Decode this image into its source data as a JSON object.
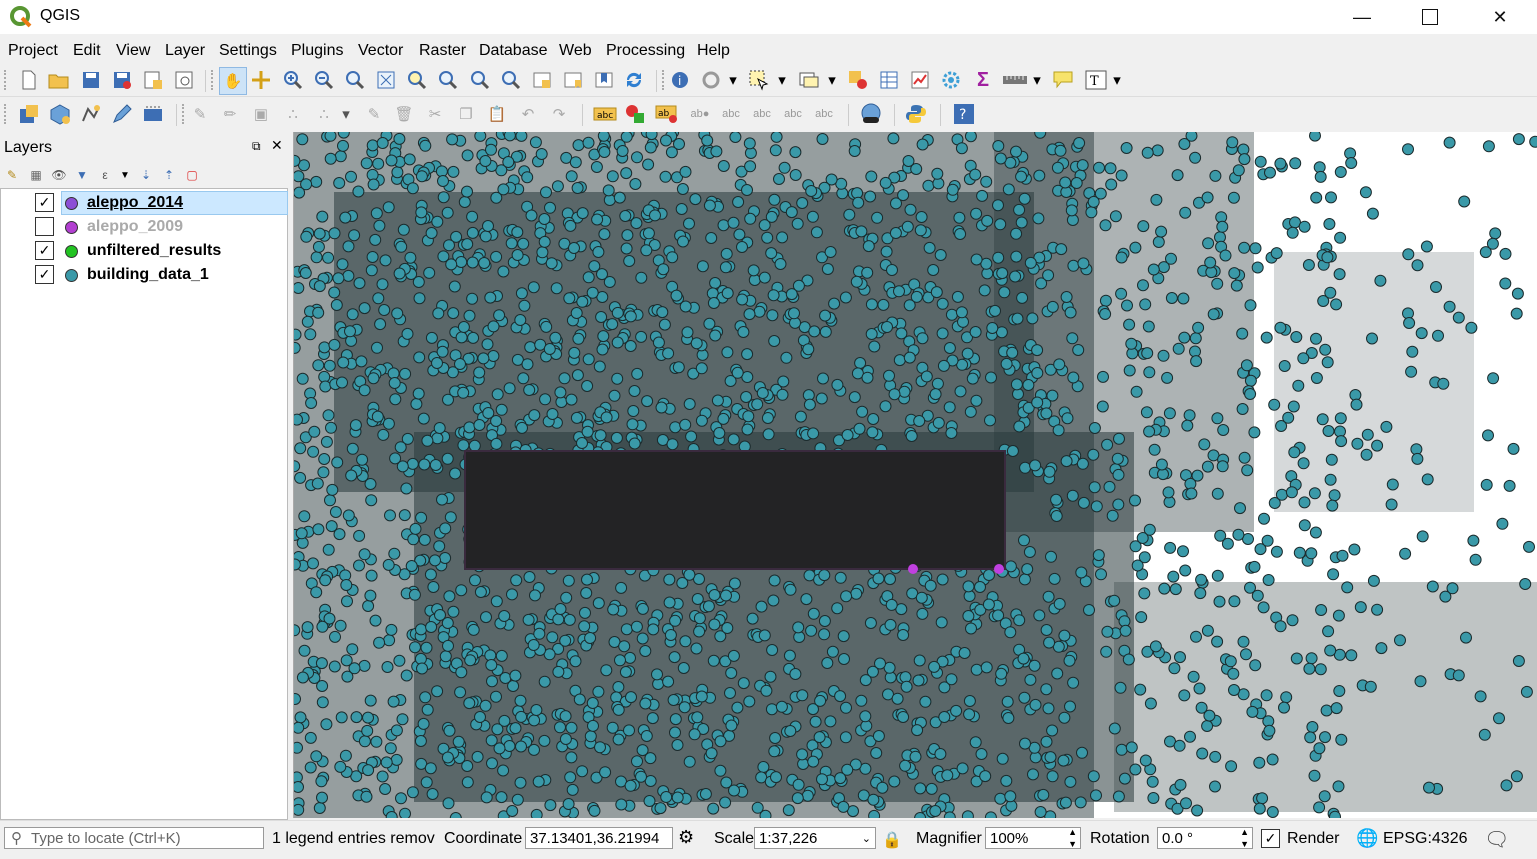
{
  "window": {
    "title": "QGIS"
  },
  "menu": [
    "Project",
    "Edit",
    "View",
    "Layer",
    "Settings",
    "Plugins",
    "Vector",
    "Raster",
    "Database",
    "Web",
    "Processing",
    "Help"
  ],
  "layers_panel": {
    "title": "Layers",
    "layers": [
      {
        "name": "aleppo_2014",
        "checked": true,
        "color": "#8c4fd6",
        "selected": true,
        "dim": false
      },
      {
        "name": "aleppo_2009",
        "checked": false,
        "color": "#b23fd1",
        "selected": false,
        "dim": true
      },
      {
        "name": "unfiltered_results",
        "checked": true,
        "color": "#22c322",
        "selected": false,
        "dim": false
      },
      {
        "name": "building_data_1",
        "checked": true,
        "color": "#3a99a8",
        "selected": false,
        "dim": false
      }
    ]
  },
  "statusbar": {
    "locate_placeholder": "Type to locate (Ctrl+K)",
    "message": "1 legend entries remov",
    "coordinate_label": "Coordinate",
    "coordinate_value": "37.13401,36.21994",
    "scale_label": "Scale",
    "scale_value": "1:37,226",
    "magnifier_label": "Magnifier",
    "magnifier_value": "100%",
    "rotation_label": "Rotation",
    "rotation_value": "0.0 °",
    "render_label": "Render",
    "crs": "EPSG:4326"
  },
  "colors": {
    "points": "#3a99a8",
    "points_dark": "#2a3a3c",
    "selection": "#c040e0"
  }
}
